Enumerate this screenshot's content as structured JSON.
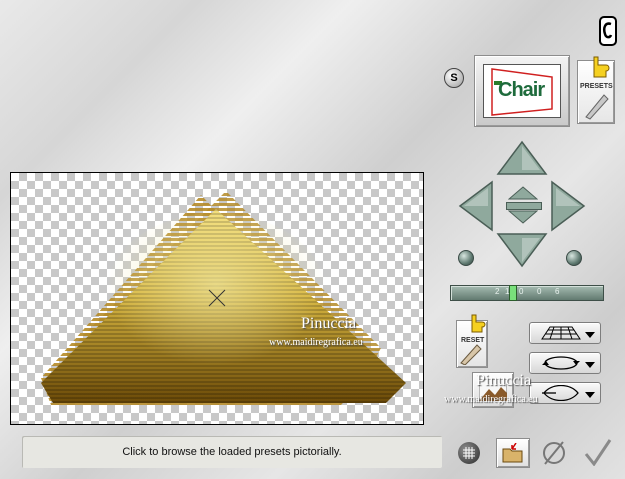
{
  "preset": {
    "preview_text": "Chair",
    "presets_label": "PRESETS",
    "s_label": "S"
  },
  "controls": {
    "reset_label": "RESET",
    "zoom_ticks": [
      "2",
      "1",
      "0",
      "0",
      "6"
    ]
  },
  "status": {
    "text": "Click to browse the loaded presets pictorially."
  },
  "watermark": {
    "name": "Pinuccia",
    "url": "www.maidiregrafica.eu"
  },
  "icons": {
    "copyright": "copyright-ear-icon",
    "nav_up": "arrow-up-icon",
    "nav_down": "arrow-down-icon",
    "nav_left": "arrow-left-icon",
    "nav_right": "arrow-right-icon",
    "rotate_left": "rotate-ccw-icon",
    "rotate_right": "rotate-cw-icon",
    "grid": "grid-icon",
    "open": "folder-open-icon",
    "cancel": "cancel-icon",
    "ok": "checkmark-icon"
  },
  "colors": {
    "gold_light": "#e8c85a",
    "gold_dark": "#6b4a08",
    "nav_green": "#8fa99d"
  }
}
